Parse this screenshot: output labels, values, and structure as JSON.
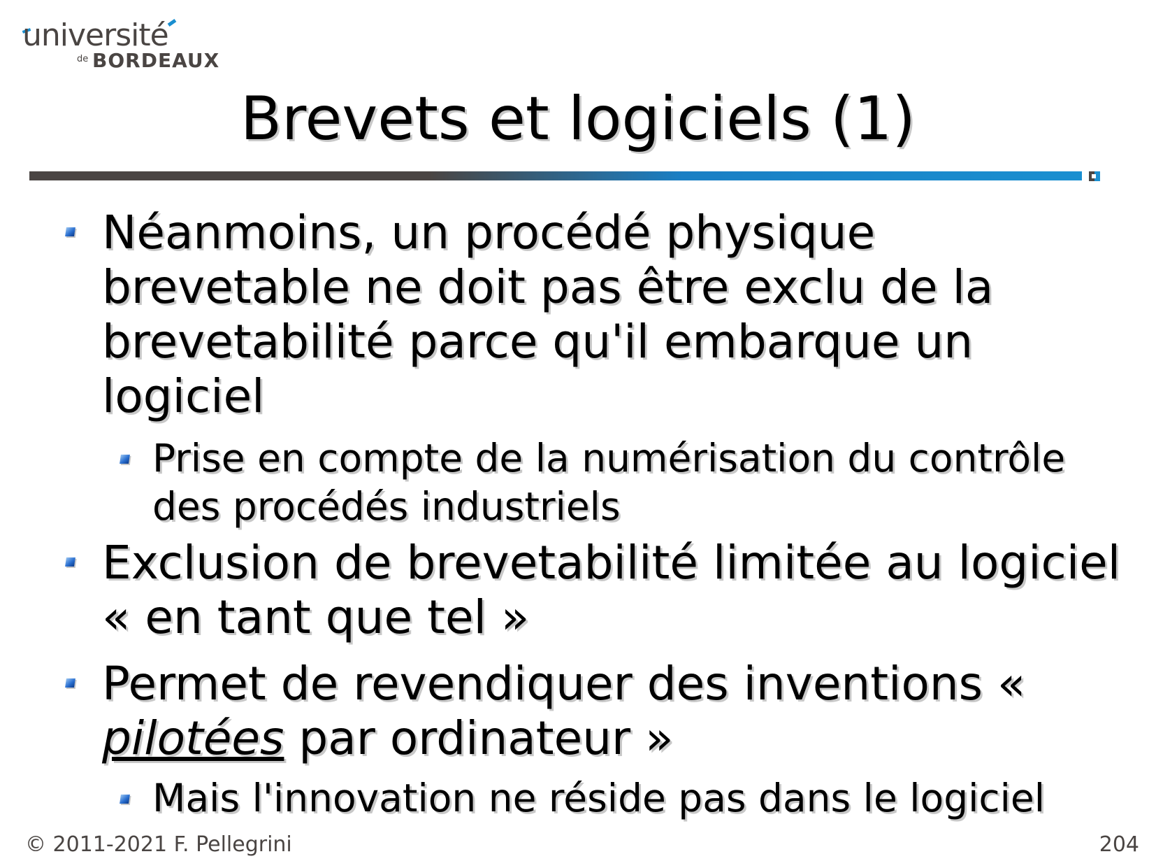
{
  "logo": {
    "line1": "université",
    "de": "de",
    "line2": "BORDEAUX"
  },
  "slide": {
    "title": "Brevets et logiciels (1)",
    "items": [
      {
        "text": "Néanmoins, un procédé physique brevetable ne doit pas être exclu de la brevetabilité parce qu'il embarque un logiciel"
      },
      {
        "text": "Prise en compte de la numérisation du contrôle des procédés industriels"
      },
      {
        "text": "Exclusion de brevetabilité limitée au logiciel « en tant que tel »"
      },
      {
        "before": "Permet de revendiquer des inventions « ",
        "emphasis": "pilotées",
        "after": " par ordinateur »"
      },
      {
        "text": "Mais l'innovation ne réside pas dans le logiciel"
      }
    ]
  },
  "footer": {
    "copyright": "© 2011-2021 F. Pellegrini",
    "page_number": "204"
  },
  "colors": {
    "rule_dark": "#4a4543",
    "rule_blue": "#1a8fd0",
    "bullet_blue": "#2a6fd0"
  }
}
